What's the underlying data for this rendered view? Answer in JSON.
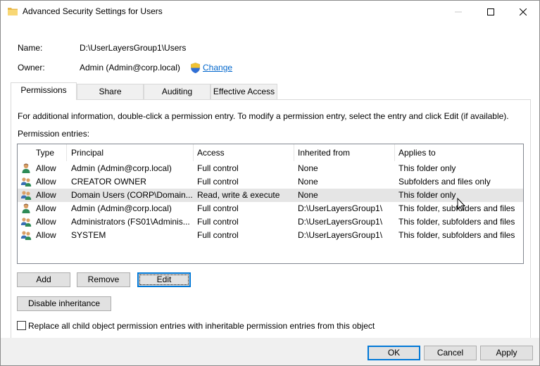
{
  "window": {
    "title": "Advanced Security Settings for Users",
    "folder_icon": "folder-icon"
  },
  "info": {
    "name_label": "Name:",
    "name_value": "D:\\UserLayersGroup1\\Users",
    "owner_label": "Owner:",
    "owner_value": "Admin (Admin@corp.local)",
    "change_label": "Change"
  },
  "tabs": [
    {
      "label": "Permissions",
      "active": true
    },
    {
      "label": "Share",
      "active": false
    },
    {
      "label": "Auditing",
      "active": false
    },
    {
      "label": "Effective Access",
      "active": false
    }
  ],
  "permissions": {
    "info_text": "For additional information, double-click a permission entry. To modify a permission entry, select the entry and click Edit (if available).",
    "entries_label": "Permission entries:",
    "columns": [
      "Type",
      "Principal",
      "Access",
      "Inherited from",
      "Applies to"
    ],
    "rows": [
      {
        "icon": "user-icon",
        "type": "Allow",
        "principal": "Admin (Admin@corp.local)",
        "access": "Full control",
        "inherited": "None",
        "applies": "This folder only"
      },
      {
        "icon": "group-icon",
        "type": "Allow",
        "principal": "CREATOR OWNER",
        "access": "Full control",
        "inherited": "None",
        "applies": "Subfolders and files only"
      },
      {
        "icon": "group-icon",
        "type": "Allow",
        "principal": "Domain Users (CORP\\Domain...",
        "access": "Read, write & execute",
        "inherited": "None",
        "applies": "This folder only"
      },
      {
        "icon": "user-icon",
        "type": "Allow",
        "principal": "Admin (Admin@corp.local)",
        "access": "Full control",
        "inherited": "D:\\UserLayersGroup1\\",
        "applies": "This folder, subfolders and files"
      },
      {
        "icon": "group-icon",
        "type": "Allow",
        "principal": "Administrators (FS01\\Adminis...",
        "access": "Full control",
        "inherited": "D:\\UserLayersGroup1\\",
        "applies": "This folder, subfolders and files"
      },
      {
        "icon": "group-icon",
        "type": "Allow",
        "principal": "SYSTEM",
        "access": "Full control",
        "inherited": "D:\\UserLayersGroup1\\",
        "applies": "This folder, subfolders and files"
      }
    ]
  },
  "buttons": {
    "add": "Add",
    "remove": "Remove",
    "edit": "Edit",
    "disable_inheritance": "Disable inheritance",
    "ok": "OK",
    "cancel": "Cancel",
    "apply": "Apply"
  },
  "replace_checkbox": {
    "label": "Replace all child object permission entries with inheritable permission entries from this object",
    "checked": false
  },
  "colors": {
    "link": "#0066cc",
    "focus_border": "#0078d7",
    "row_hover": "#e5e5e5"
  }
}
